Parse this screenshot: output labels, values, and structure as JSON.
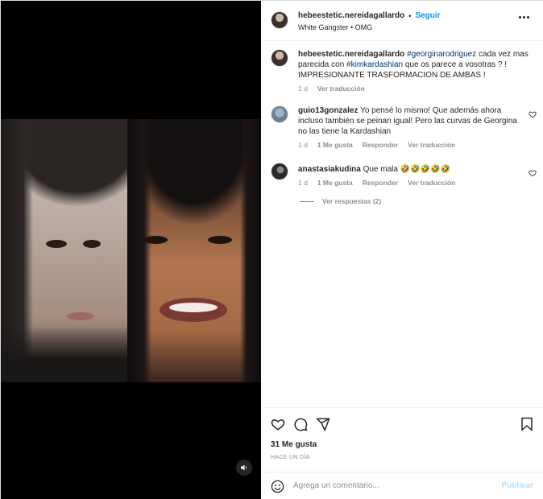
{
  "post": {
    "username": "hebeestetic.nereidagallardo",
    "separator": "•",
    "follow_label": "Seguir",
    "audio": "White Gangster • OMG",
    "caption": {
      "username": "hebeestetic.nereidagallardo",
      "tag1": "#georginarodriguez",
      "text1": " cada vez mas parecida con ",
      "tag2": "#kimkardashian",
      "text2": " que os parece a vosotras ? ! IMPRESIONANTE TRASFORMACION DE AMBAS !",
      "age": "1 d",
      "translate": "Ver traducción"
    }
  },
  "comments": [
    {
      "username": "guio13gonzalez",
      "text": "Yo pensé lo mismo! Que además ahora incluso también se peinan igual! Pero las curvas de Georgina no las tiene la Kardashian",
      "age": "1 d",
      "likes": "1 Me gusta",
      "reply": "Responder",
      "translate": "Ver traducción"
    },
    {
      "username": "anastasiakudina",
      "text": "Que mala 🤣🤣🤣🤣🤣",
      "age": "1 d",
      "likes": "1 Me gusta",
      "reply": "Responder",
      "translate": "Ver traducción",
      "view_replies": "Ver respuestas (2)"
    }
  ],
  "footer": {
    "likes": "31 Me gusta",
    "time": "HACE UN DÍA",
    "placeholder": "Agrega un comentario...",
    "publish": "Publicar"
  },
  "icons": [
    "heart-icon",
    "comment-icon",
    "share-icon",
    "bookmark-icon",
    "emoji-icon",
    "more-icon",
    "mute-icon"
  ],
  "colors": {
    "link": "#0095f6",
    "tag": "#00376b",
    "muted": "#8e8e8e",
    "publish_disabled": "#b2dffc"
  }
}
